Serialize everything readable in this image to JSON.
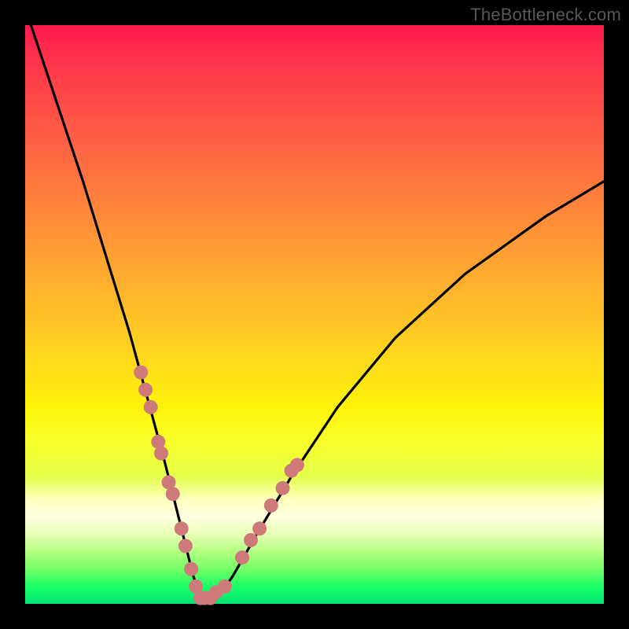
{
  "watermark": "TheBottleneck.com",
  "colors": {
    "frame": "#000000",
    "gradient_top": "#ff1a4d",
    "gradient_bottom": "#00e673",
    "curve_stroke": "#000000",
    "dot_fill": "#cf7a7a"
  },
  "chart_data": {
    "type": "line",
    "title": "",
    "xlabel": "",
    "ylabel": "",
    "xlim": [
      0,
      100
    ],
    "ylim": [
      0,
      100
    ],
    "grid": false,
    "legend": false,
    "x": [
      1,
      5,
      10,
      14,
      18,
      21,
      24,
      26,
      28,
      29,
      30,
      31,
      32,
      34,
      36,
      40,
      46,
      54,
      64,
      76,
      90,
      100
    ],
    "values": [
      100,
      88,
      73,
      60,
      47,
      36,
      25,
      17,
      9,
      5,
      2,
      1,
      1,
      2,
      5,
      12,
      22,
      34,
      46,
      57,
      67,
      73
    ],
    "dots_left": {
      "x": [
        20.0,
        20.8,
        21.7,
        23.0,
        23.5,
        24.8,
        25.5,
        27.0,
        27.7,
        28.7,
        29.5,
        30.3,
        31.0
      ],
      "values": [
        40,
        37,
        34,
        28,
        26,
        21,
        19,
        13,
        10,
        6,
        3,
        1,
        1
      ]
    },
    "dots_right": {
      "x": [
        32.0,
        33.0,
        34.5,
        37.5,
        39.0,
        40.5,
        42.5,
        44.5,
        46.0,
        47.0
      ],
      "values": [
        1,
        2,
        3,
        8,
        11,
        13,
        17,
        20,
        23,
        24
      ]
    }
  }
}
